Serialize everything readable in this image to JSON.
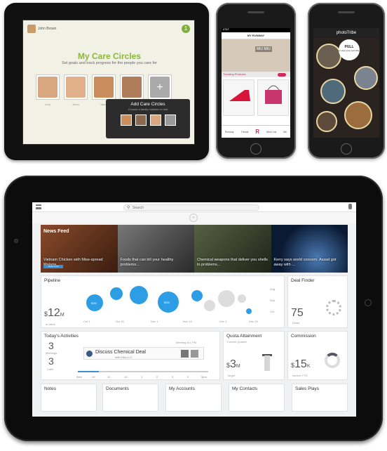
{
  "care_circles": {
    "user_name": "John Brown",
    "badge": "1",
    "title": "My Care Circles",
    "subtitle": "Set goals and track progress for the people you care for",
    "names": [
      "Lucy",
      "Anna",
      "Jason",
      "Mark",
      ""
    ],
    "popup_title": "Add Care Circles",
    "popup_subtitle": "Choose a family member to add",
    "add_symbol": "+"
  },
  "phone1": {
    "status": "AT&T",
    "header": "MY RUNWAY",
    "hero_text": "MIU MIU",
    "bar_label": "Trending Products",
    "tabs": [
      "Runway",
      "Trends",
      "R",
      "Wish List",
      "Me"
    ],
    "brand_letter": "R"
  },
  "phone2": {
    "header": "photoTribe",
    "pull_label": "PULL",
    "pull_sub": "to view your pool tribe"
  },
  "app": {
    "search_placeholder": "Search",
    "plus": "+",
    "news": {
      "label": "News Feed",
      "button": "Read more",
      "items": [
        "Vietnam Chicken with Mise-spread Malaria...",
        "Foods that can kill your healthy problems...",
        "Chemical weapons that deliver you shells to problems...",
        "Kerry says world concern. Assad got away with ..."
      ]
    },
    "pipeline": {
      "title": "Pipeline",
      "currency": "$",
      "value": "12",
      "unit": "M",
      "sub": "in value",
      "x_labels": [
        "Oct 1",
        "Oct 15",
        "Nov 1",
        "Nov 15",
        "Dec 1",
        "Dec 15"
      ],
      "bubble_label": "$2M",
      "bubble_label2": "$1M",
      "right_labels": [
        "Aug",
        "Sep",
        "Oct"
      ]
    },
    "deal_finder": {
      "title": "Deal Finder",
      "value": "75",
      "sub": "Deals"
    },
    "activities": {
      "title": "Today's Activities",
      "count1": "3",
      "count1_label": "Meetings",
      "count2": "3",
      "count2_label": "Calls",
      "time_label": "Meeting at 1 PM",
      "event_title": "Discuss Chemical Deal",
      "event_sub": "with Kiko LLC",
      "timeline": [
        "9am",
        "10",
        "11",
        "12",
        "1",
        "2",
        "3",
        "4",
        "5pm"
      ]
    },
    "quota": {
      "title": "Quota Attainment",
      "sub": "Current Quarter",
      "currency": "$",
      "value": "3",
      "unit": "M",
      "foot": "target"
    },
    "commission": {
      "title": "Commission",
      "currency": "$",
      "value": "15",
      "unit": "K",
      "foot": "earned YTD"
    },
    "bottom_tiles": [
      "Notes",
      "Documents",
      "My Accounts",
      "My Contacts",
      "Sales Plays"
    ]
  }
}
